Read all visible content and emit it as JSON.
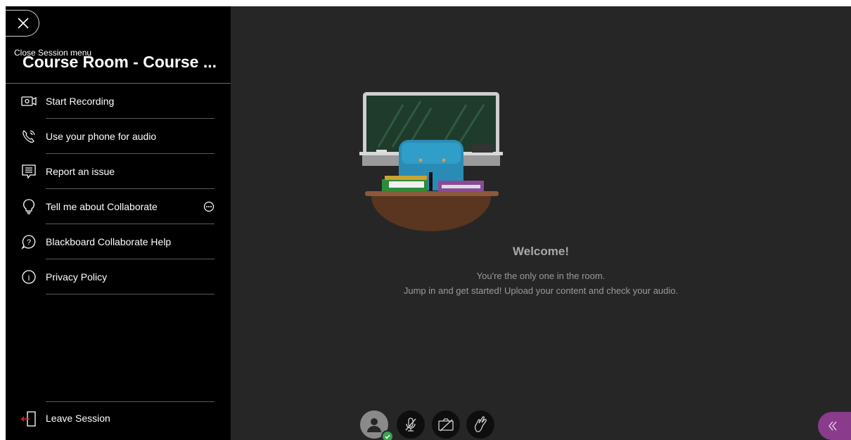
{
  "session_menu": {
    "close_tooltip": "Close Session menu",
    "title": "Course Room - Course ...",
    "items": [
      {
        "label": "Start Recording",
        "icon": "record-camera-icon"
      },
      {
        "label": "Use your phone for audio",
        "icon": "phone-icon"
      },
      {
        "label": "Report an issue",
        "icon": "report-issue-icon"
      },
      {
        "label": "Tell me about Collaborate",
        "icon": "lightbulb-icon",
        "extra_icon": "more-options-icon"
      },
      {
        "label": "Blackboard Collaborate Help",
        "icon": "help-icon"
      },
      {
        "label": "Privacy Policy",
        "icon": "info-icon"
      }
    ],
    "leave_label": "Leave Session"
  },
  "stage": {
    "welcome_title": "Welcome!",
    "line1": "You're the only one in the room.",
    "line2": "Jump in and get started! Upload your content and check your audio."
  },
  "controls": {
    "avatar": "avatar-icon",
    "mic": "mic-muted-icon",
    "camera": "camera-off-icon",
    "hand": "raise-hand-icon",
    "panel": "double-chevron-left-icon"
  },
  "colors": {
    "menu_bg": "#000000",
    "stage_bg": "#262626",
    "accent_purple": "#8b3b8b",
    "status_green": "#37a34a",
    "leave_red": "#e0262b"
  }
}
